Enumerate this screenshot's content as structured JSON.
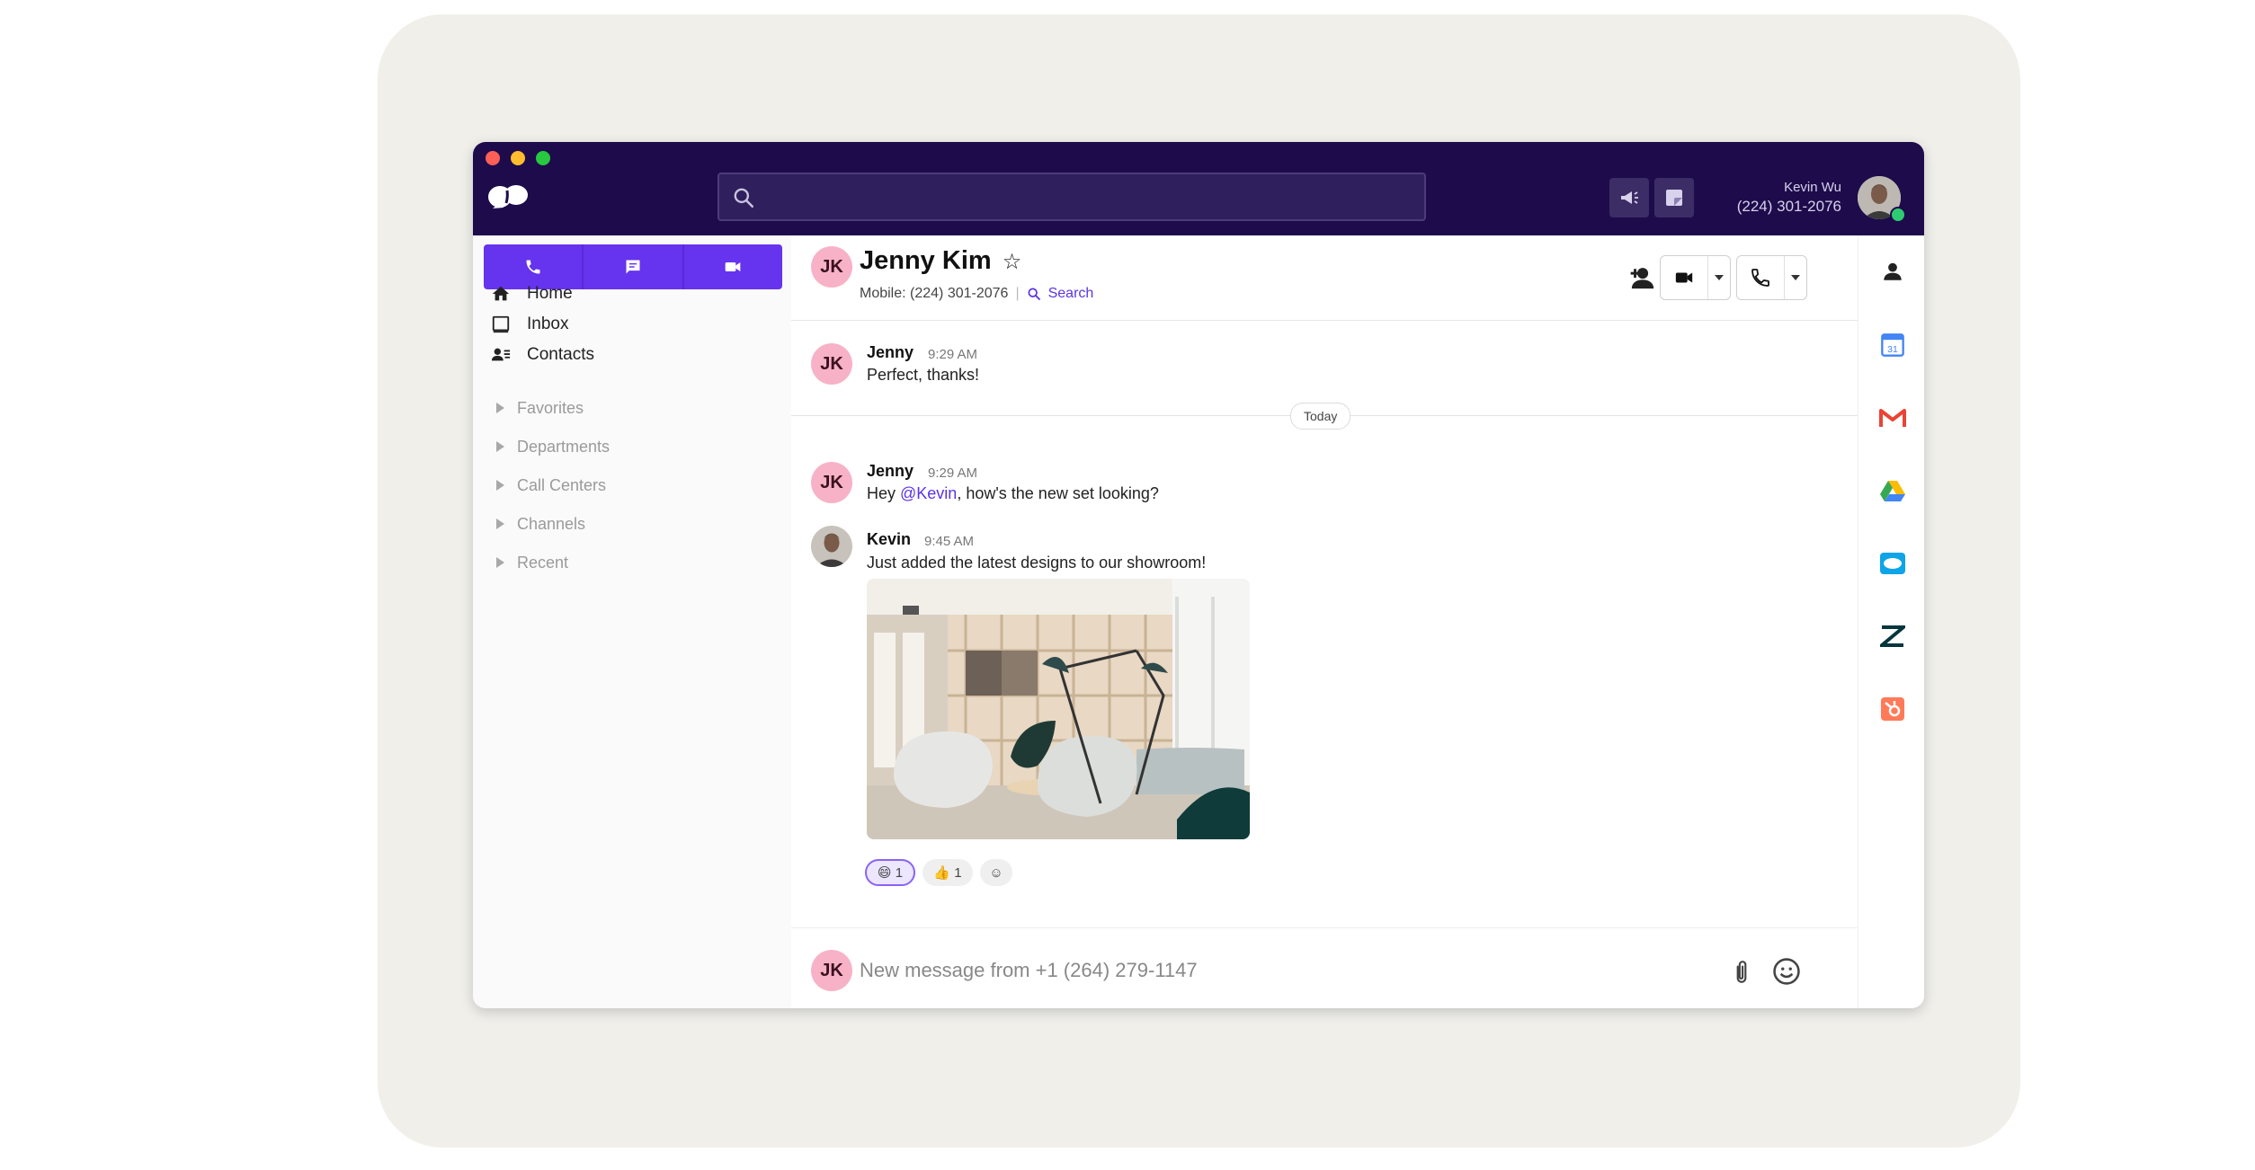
{
  "window": {
    "traffic_lights": [
      "close",
      "minimize",
      "zoom"
    ],
    "logo_icon": "dialpad-logo-icon"
  },
  "topbar": {
    "search_placeholder": "",
    "user": {
      "name": "Kevin Wu",
      "phone": "(224) 301-2076",
      "status": "online"
    }
  },
  "sidebar": {
    "action_buttons": [
      "phone-icon",
      "message-icon",
      "video-icon"
    ],
    "nav": [
      {
        "label": "Home",
        "icon": "home-icon"
      },
      {
        "label": "Inbox",
        "icon": "inbox-icon"
      },
      {
        "label": "Contacts",
        "icon": "contacts-icon"
      }
    ],
    "groups": [
      "Favorites",
      "Departments",
      "Call Centers",
      "Channels",
      "Recent"
    ]
  },
  "conversation": {
    "contact": {
      "initials": "JK",
      "name": "Jenny Kim",
      "mobile_label": "Mobile: (224) 301-2076",
      "search_label": "Search"
    },
    "divider_label": "Today",
    "messages": [
      {
        "initials": "JK",
        "author": "Jenny",
        "time": "9:29 AM",
        "text": "Perfect, thanks!"
      },
      {
        "initials": "JK",
        "author": "Jenny",
        "time": "9:29 AM",
        "text_before": "Hey ",
        "mention": "@Kevin",
        "text_after": ", how's the new set looking?"
      },
      {
        "author": "Kevin",
        "time": "9:45 AM",
        "text": "Just added the latest designs to our showroom!"
      }
    ],
    "reactions": [
      {
        "emoji": "😄",
        "count": "1",
        "selected": true
      },
      {
        "emoji": "👍",
        "count": "1",
        "selected": false
      },
      {
        "emoji": "☺",
        "count": "",
        "selected": false
      }
    ],
    "composer": {
      "initials": "JK",
      "placeholder": "New message from +1 (264) 279-1147"
    }
  },
  "rail": {
    "integrations": [
      "person-icon",
      "google-calendar-icon",
      "gmail-icon",
      "google-drive-icon",
      "salesforce-icon",
      "zendesk-icon",
      "hubspot-icon"
    ],
    "calendar_day": "31"
  },
  "colors": {
    "topbar": "#1e0b4b",
    "accent": "#6633ee",
    "avatar_pink": "#f7b2c7",
    "mention": "#5b33e6"
  }
}
